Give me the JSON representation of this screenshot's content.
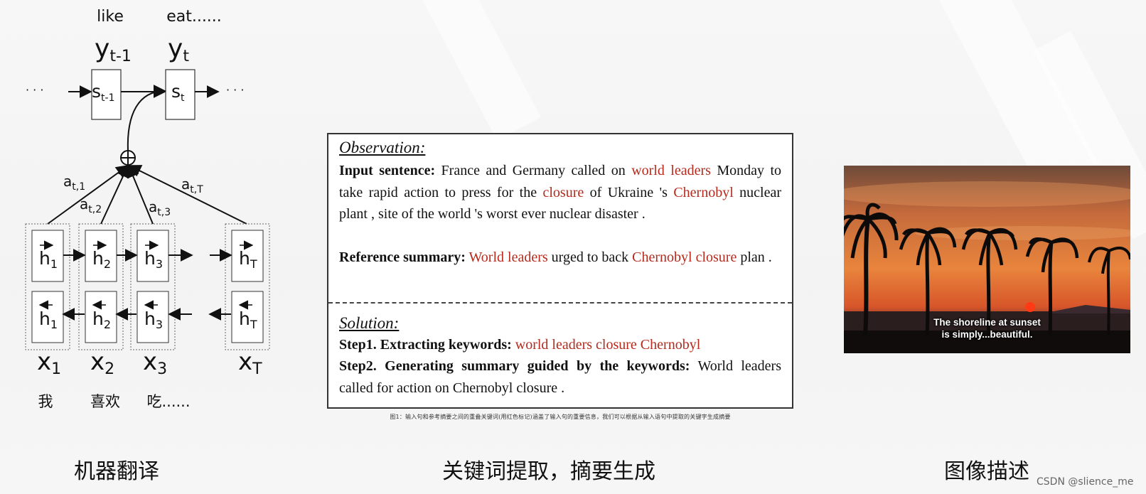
{
  "diagram": {
    "top_words": [
      "like",
      "eat......"
    ],
    "outputs": [
      {
        "base": "y",
        "sub": "t-1"
      },
      {
        "base": "y",
        "sub": "t"
      }
    ],
    "states": [
      {
        "base": "s",
        "sub": "t-1"
      },
      {
        "base": "s",
        "sub": "t"
      }
    ],
    "ellipsis": "· · ·",
    "attention": [
      {
        "base": "a",
        "sub": "t,1"
      },
      {
        "base": "a",
        "sub": "t,2"
      },
      {
        "base": "a",
        "sub": "t,3"
      },
      {
        "base": "a",
        "sub": "t,T"
      }
    ],
    "hidden_subs": [
      "1",
      "2",
      "3",
      "T"
    ],
    "hidden_base": "h",
    "inputs": [
      {
        "base": "x",
        "sub": "1"
      },
      {
        "base": "x",
        "sub": "2"
      },
      {
        "base": "x",
        "sub": "3"
      },
      {
        "base": "x",
        "sub": "T"
      }
    ],
    "input_words": [
      "我",
      "喜欢",
      "吃......"
    ]
  },
  "figure": {
    "observation_title": "Observation:",
    "input_label": "Input sentence:",
    "input_parts": [
      " France and Germany called on ",
      "world leaders",
      " Monday to take rapid action to press for the ",
      "closure",
      " of Ukraine 's ",
      "Chernobyl",
      " nuclear plant , site of the world 's worst ever nuclear disaster ."
    ],
    "reference_label": "Reference summary:",
    "reference_parts": [
      " ",
      "World leaders",
      " urged to back ",
      "Chernobyl closure",
      " plan ."
    ],
    "solution_title": "Solution:",
    "step1_label": "Step1. Extracting keywords:",
    "step1_keywords": "world leaders closure Chernobyl",
    "step2_label": "Step2. Generating summary guided by the keywords:",
    "step2_text": " World leaders called for action on Chernobyl closure .",
    "caption": "图1：输入句和参考摘要之间的重叠关键词(用红色标记)涵盖了输入句的重要信息，我们可以根据从输入语句中提取的关键字生成摘要"
  },
  "photo": {
    "caption_line1": "The shoreline at sunset",
    "caption_line2": "is simply...beautiful."
  },
  "labels": {
    "left": "机器翻译",
    "center": "关键词提取，摘要生成",
    "right": "图像描述"
  },
  "watermark": "CSDN @slience_me",
  "colors": {
    "keyword_red": "#b52a1c",
    "sunset_orange": "#e8703a"
  }
}
